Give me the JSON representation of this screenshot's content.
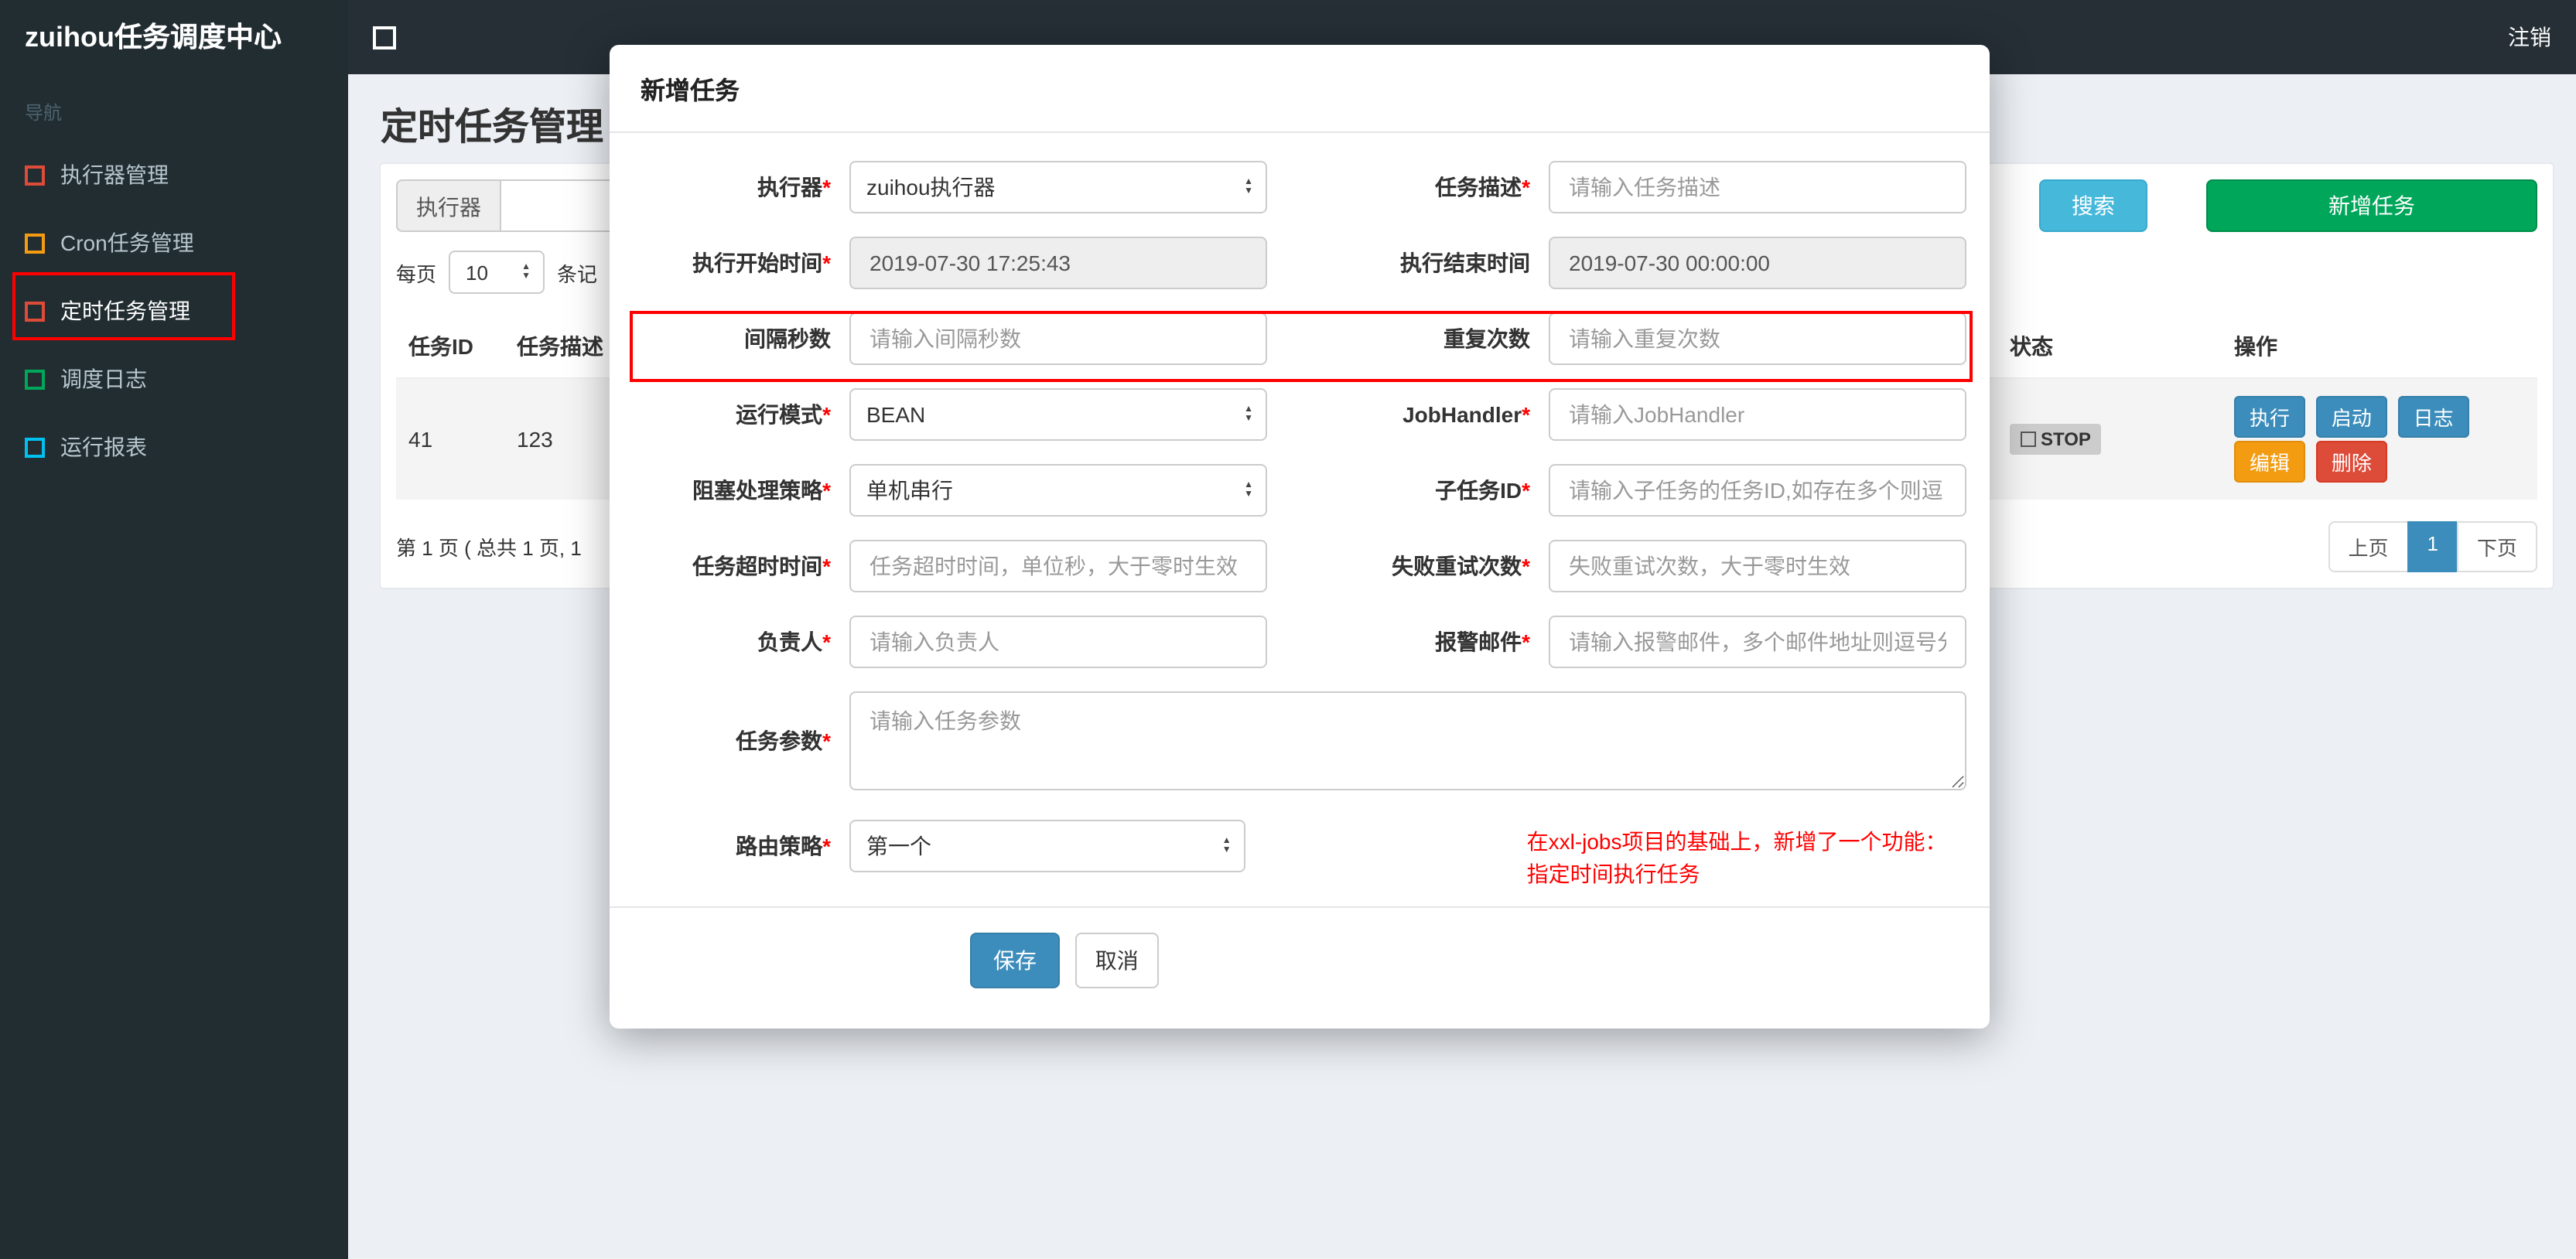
{
  "colors": {
    "primary": "#3c8dbc",
    "success": "#00a65a",
    "info": "#46b8da",
    "warning": "#f39c12",
    "danger": "#dd4b39",
    "annotation": "#ff0000",
    "sidebar_bg": "#222d32",
    "navbar_bg": "#252f35",
    "content_bg": "#ecf0f5"
  },
  "navbar": {
    "brand": "zuihou任务调度中心",
    "logout": "注销"
  },
  "sidebar": {
    "header": "导航",
    "items": [
      {
        "label": "执行器管理",
        "icon": "square-icon",
        "color": "#dd4b39"
      },
      {
        "label": "Cron任务管理",
        "icon": "square-icon",
        "color": "#f39c12"
      },
      {
        "label": "定时任务管理",
        "icon": "square-icon",
        "color": "#dd4b39",
        "active": true,
        "annotated": true
      },
      {
        "label": "调度日志",
        "icon": "square-icon",
        "color": "#00a65a"
      },
      {
        "label": "运行报表",
        "icon": "square-icon",
        "color": "#00c0ef"
      }
    ]
  },
  "page": {
    "title": "定时任务管理",
    "filter": {
      "executor_label": "执行器",
      "executor_value": "",
      "search_button": "搜索",
      "add_button": "新增任务"
    },
    "per_page": {
      "label": "每页",
      "value": "10",
      "suffix": "条记"
    },
    "table": {
      "headers": [
        "任务ID",
        "任务描述",
        "状态",
        "操作"
      ],
      "row": {
        "id": "41",
        "desc": "123",
        "status": "STOP",
        "actions": [
          "执行",
          "启动",
          "日志",
          "编辑",
          "删除"
        ]
      }
    },
    "pagination": {
      "summary": "第 1 页 ( 总共 1 页, 1",
      "prev": "上页",
      "current": "1",
      "next": "下页"
    }
  },
  "modal": {
    "title": "新增任务",
    "fields": {
      "executor": {
        "label": "执行器",
        "req": "*",
        "value": "zuihou执行器"
      },
      "desc": {
        "label": "任务描述",
        "req": "*",
        "placeholder": "请输入任务描述"
      },
      "start": {
        "label": "执行开始时间",
        "req": "*",
        "value": "2019-07-30 17:25:43"
      },
      "end": {
        "label": "执行结束时间",
        "value": "2019-07-30 00:00:00"
      },
      "interval": {
        "label": "间隔秒数",
        "placeholder": "请输入间隔秒数"
      },
      "repeat": {
        "label": "重复次数",
        "placeholder": "请输入重复次数"
      },
      "mode": {
        "label": "运行模式",
        "req": "*",
        "value": "BEAN"
      },
      "handler": {
        "label": "JobHandler",
        "req": "*",
        "placeholder": "请输入JobHandler"
      },
      "block": {
        "label": "阻塞处理策略",
        "req": "*",
        "value": "单机串行"
      },
      "child": {
        "label": "子任务ID",
        "req": "*",
        "placeholder": "请输入子任务的任务ID,如存在多个则逗"
      },
      "timeout": {
        "label": "任务超时时间",
        "req": "*",
        "placeholder": "任务超时时间，单位秒，大于零时生效"
      },
      "retry": {
        "label": "失败重试次数",
        "req": "*",
        "placeholder": "失败重试次数，大于零时生效"
      },
      "owner": {
        "label": "负责人",
        "req": "*",
        "placeholder": "请输入负责人"
      },
      "email": {
        "label": "报警邮件",
        "req": "*",
        "placeholder": "请输入报警邮件，多个邮件地址则逗号分"
      },
      "params": {
        "label": "任务参数",
        "req": "*",
        "placeholder": "请输入任务参数"
      },
      "route": {
        "label": "路由策略",
        "req": "*",
        "value": "第一个"
      }
    },
    "note_line1": "在xxl-jobs项目的基础上，新增了一个功能：",
    "note_line2": "指定时间执行任务",
    "save_label": "保存",
    "cancel_label": "取消"
  }
}
